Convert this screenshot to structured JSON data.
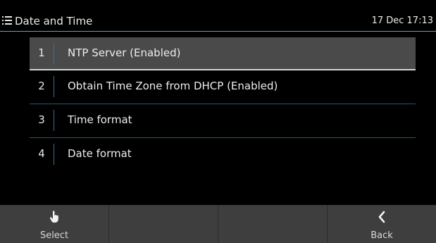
{
  "header": {
    "menu_icon": "hamburger-menu-icon",
    "title": "Date and Time",
    "clock": "17 Dec 17:13"
  },
  "list": {
    "items": [
      {
        "number": "1",
        "label": "NTP Server (Enabled)",
        "selected": true
      },
      {
        "number": "2",
        "label": "Obtain Time Zone from DHCP (Enabled)",
        "selected": false
      },
      {
        "number": "3",
        "label": "Time format",
        "selected": false
      },
      {
        "number": "4",
        "label": "Date format",
        "selected": false
      }
    ]
  },
  "softkeys": {
    "select": {
      "label": "Select",
      "icon": "hand-pointer-icon"
    },
    "empty1": {
      "label": ""
    },
    "empty2": {
      "label": ""
    },
    "back": {
      "label": "Back",
      "icon": "chevron-left-icon"
    }
  },
  "colors": {
    "accent": "#5aa3c8",
    "selected_row": "#4a4a4a",
    "softkey_bar": "#3e3e3e"
  }
}
